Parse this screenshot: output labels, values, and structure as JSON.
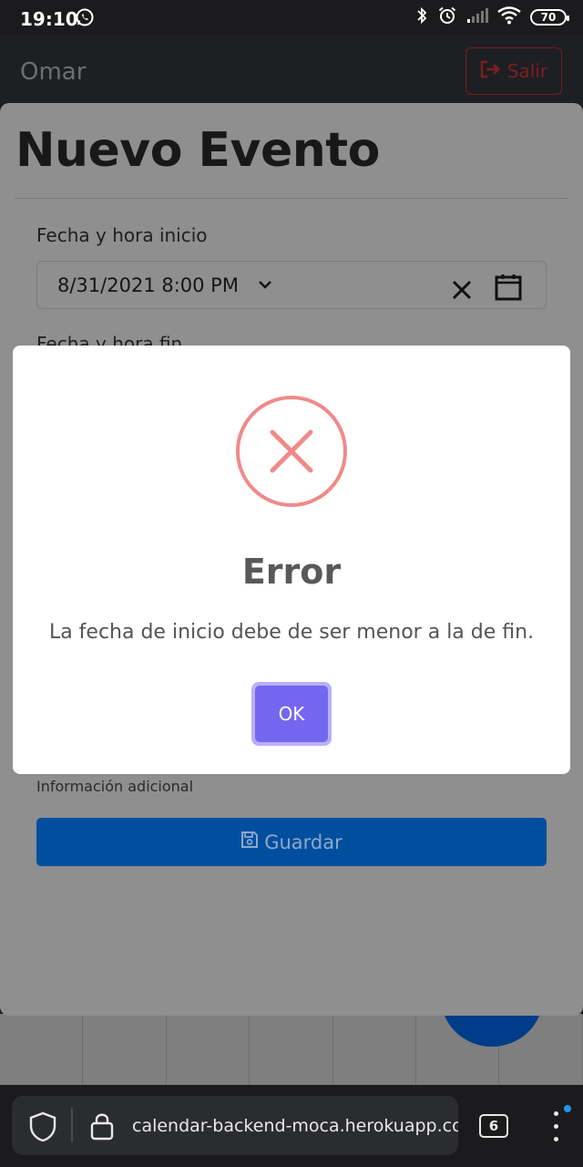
{
  "status_bar": {
    "time": "19:10",
    "battery": "70"
  },
  "navbar": {
    "user_name": "Omar",
    "logout_label": "Salir"
  },
  "event_form": {
    "title": "Nuevo Evento",
    "start_label": "Fecha y hora inicio",
    "start_value": "8/31/2021 8:00   PM",
    "end_label": "Fecha y hora fin",
    "additional_info_label": "Información adicional",
    "save_label": "Guardar"
  },
  "alert": {
    "title": "Error",
    "message": "La fecha de inicio debe de ser menor a la de fin.",
    "ok_label": "OK"
  },
  "browser": {
    "url": "calendar-backend-moca.herokuapp.com",
    "tab_count": "6"
  },
  "colors": {
    "error_icon": "#f08a8a",
    "ok_button": "#7367f0",
    "save_button": "#004f9f",
    "logout_text": "#7d1e24"
  }
}
